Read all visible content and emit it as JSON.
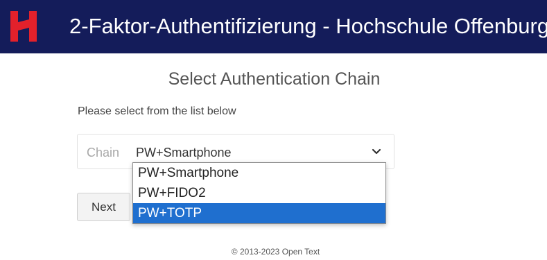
{
  "header": {
    "title": "2-Faktor-Authentifizierung - Hochschule Offenburg",
    "background_color": "#141c5a",
    "logo_icon": "hochschule-logo-icon",
    "logo_color": "#e3212b"
  },
  "main": {
    "title": "Select Authentication Chain",
    "instruction": "Please select from the list below",
    "chain_select": {
      "prefix": "Chain",
      "selected_value": "PW+Smartphone",
      "chevron_icon": "chevron-down-icon",
      "options": [
        {
          "label": "PW+Smartphone",
          "highlighted": false
        },
        {
          "label": "PW+FIDO2",
          "highlighted": false
        },
        {
          "label": "PW+TOTP",
          "highlighted": true
        }
      ],
      "highlight_color": "#1f6fcf"
    },
    "next_button": "Next"
  },
  "footer": {
    "copyright": "© 2013-2023 Open Text"
  }
}
